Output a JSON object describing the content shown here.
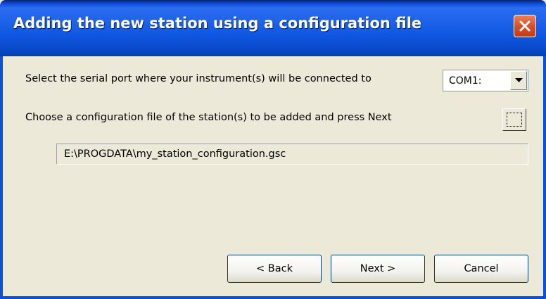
{
  "window": {
    "title": "Adding the new station using a configuration file"
  },
  "serial_port": {
    "label": "Select the serial port where your instrument(s) will be connected to",
    "selected": "COM1:"
  },
  "config_file": {
    "label": "Choose a configuration file of the station(s) to be added and press Next",
    "path": "E:\\PROGDATA\\my_station_configuration.gsc"
  },
  "buttons": {
    "back": "< Back",
    "next": "Next >",
    "cancel": "Cancel"
  },
  "icons": {
    "close": "close-icon",
    "dropdown": "chevron-down-icon",
    "browse": "browse-icon"
  },
  "colors": {
    "titlebar": "#0c52e0",
    "dialog_bg": "#ece9d8",
    "close_button": "#d8502a"
  }
}
